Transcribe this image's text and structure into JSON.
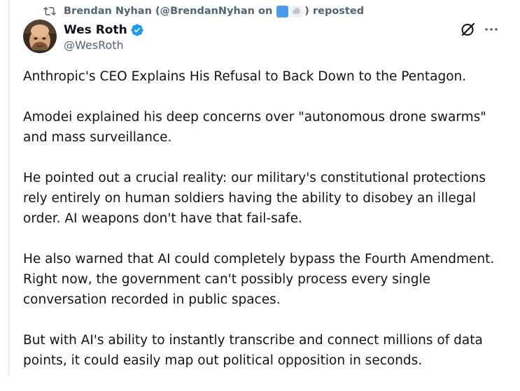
{
  "repost": {
    "prefix": "Brendan Nyhan (@BrendanNyhan on",
    "suffix": ") reposted"
  },
  "author": {
    "display_name": "Wes Roth",
    "handle": "@WesRoth"
  },
  "icons": {
    "repost": "repost-icon",
    "verified": "verified-badge-icon",
    "grok": "grok-icon",
    "more": "more-options-icon"
  },
  "colors": {
    "verified": "#1d9bf0",
    "secondary_text": "#536471",
    "primary_text": "#0f1419"
  },
  "post": {
    "paragraphs": [
      "Anthropic's CEO Explains His Refusal to Back Down to the Pentagon.",
      "Amodei explained his deep concerns over \"autonomous drone swarms\" and mass surveillance.",
      "He pointed out a crucial reality: our military's constitutional protections rely entirely on human soldiers having the ability to disobey an illegal order. AI weapons don't have that fail-safe.",
      "He also warned that AI could completely bypass the Fourth Amendment. Right now, the government can't possibly process every single conversation recorded in public spaces.",
      "But with AI's ability to instantly transcribe and connect millions of data points, it could easily map out political opposition in seconds."
    ]
  }
}
